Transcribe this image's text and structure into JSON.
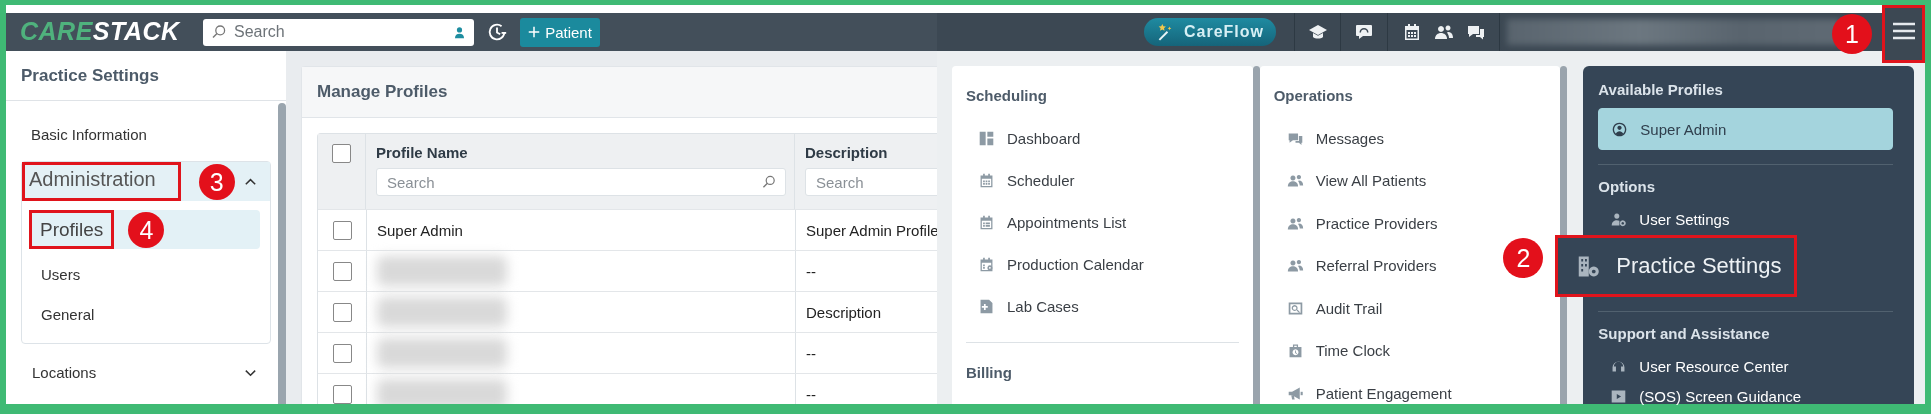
{
  "header": {
    "logo": {
      "accent": "CARE",
      "rest": "STACK"
    },
    "search": {
      "placeholder": "Search"
    },
    "new_patient_button": "Patient"
  },
  "sidebar": {
    "title": "Practice Settings",
    "items": [
      {
        "kind": "link",
        "label": "Basic Information"
      },
      {
        "kind": "group",
        "label": "Administration",
        "expanded": true,
        "callout": "3",
        "children": [
          {
            "label": "Profiles",
            "selected": true,
            "callout": "4"
          },
          {
            "label": "Users",
            "selected": false
          },
          {
            "label": "General",
            "selected": false
          }
        ]
      },
      {
        "kind": "group",
        "label": "Locations",
        "expanded": false
      }
    ]
  },
  "page": {
    "title": "Manage Profiles",
    "table": {
      "select_all_checked": false,
      "columns": [
        {
          "label": "Profile Name",
          "filter_placeholder": "Search"
        },
        {
          "label": "Description",
          "filter_placeholder": "Search"
        }
      ],
      "rows": [
        {
          "checked": false,
          "profile_name": "Super Admin",
          "description": "Super Admin Profile"
        },
        {
          "checked": false,
          "profile_name_redacted": true,
          "description": "--"
        },
        {
          "checked": false,
          "profile_name_redacted": true,
          "description": "Description"
        },
        {
          "checked": false,
          "profile_name_redacted": true,
          "description": "--"
        },
        {
          "checked": false,
          "profile_name_redacted": true,
          "description": "--"
        }
      ]
    }
  },
  "menu_bar": {
    "careflow_button": "CareFlow",
    "account_redacted": true,
    "menu_button": {
      "callout": "1"
    }
  },
  "menu": {
    "columns": [
      {
        "sections": [
          {
            "heading": "Scheduling",
            "items": [
              "Dashboard",
              "Scheduler",
              "Appointments List",
              "Production Calendar",
              "Lab Cases"
            ]
          },
          {
            "heading": "Billing"
          }
        ]
      },
      {
        "sections": [
          {
            "heading": "Operations",
            "items": [
              "Messages",
              "View All Patients",
              "Practice Providers",
              "Referral Providers",
              "Audit Trail",
              "Time Clock",
              "Patient Engagement"
            ]
          }
        ]
      }
    ]
  },
  "account_panel": {
    "sections": [
      {
        "heading": "Available Profiles",
        "items": [
          {
            "kind": "profile",
            "label": "Super Admin",
            "selected": true
          }
        ]
      },
      {
        "heading": "Options",
        "items": [
          {
            "kind": "option",
            "label": "User Settings",
            "selected": false
          },
          {
            "kind": "option",
            "label": "Practice Settings",
            "selected": true,
            "callout": "2"
          }
        ]
      },
      {
        "heading": "Support and Assistance",
        "items": [
          {
            "kind": "option",
            "label": "User Resource Center",
            "selected": false
          },
          {
            "kind": "option",
            "label": "(SOS) Screen Guidance",
            "selected": false
          }
        ]
      }
    ]
  }
}
